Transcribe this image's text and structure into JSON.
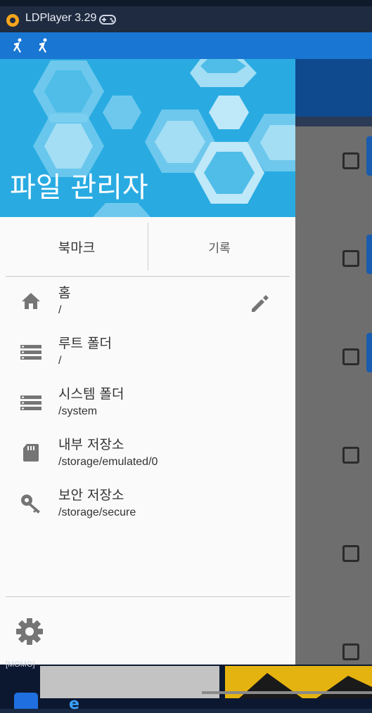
{
  "window": {
    "title": "LDPlayer 3.29",
    "app_icon": "ldplayer-logo",
    "gamepad_icon": "gamepad-icon"
  },
  "statusbar": {
    "icons": [
      "runner-icon",
      "runner-icon"
    ]
  },
  "drawer": {
    "header_title": "파일 관리자",
    "tabs": [
      {
        "label": "북마크"
      },
      {
        "label": "기록"
      }
    ],
    "items": [
      {
        "title": "홈",
        "path": "/",
        "icon": "home-icon"
      },
      {
        "title": "루트 폴더",
        "path": "/",
        "icon": "storage-icon"
      },
      {
        "title": "시스템 폴더",
        "path": "/system",
        "icon": "storage-icon"
      },
      {
        "title": "내부 저장소",
        "path": "/storage/emulated/0",
        "icon": "sd-card-icon"
      },
      {
        "title": "보안 저장소",
        "path": "/storage/secure",
        "icon": "key-icon"
      }
    ],
    "edit_icon": "pencil-icon",
    "settings_icon": "gear-icon"
  },
  "taskbar": {
    "label": "[MOMO]"
  },
  "colors": {
    "header": "#29abe2",
    "statusbar": "#1976d2",
    "accent": "#1a5cae"
  }
}
